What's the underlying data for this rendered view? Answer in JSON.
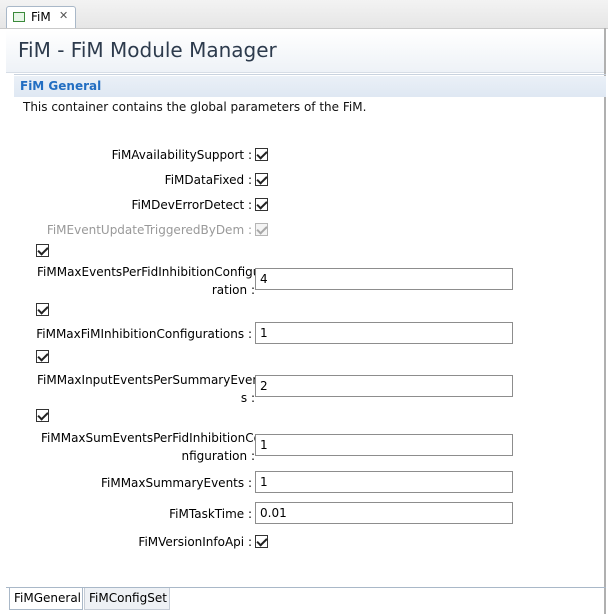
{
  "editor_tab": {
    "label": "FiM",
    "close_glyph": "✕",
    "icon": "module-icon"
  },
  "header": {
    "title": "FiM - FiM Module Manager"
  },
  "section": {
    "title": "FiM General",
    "description": "This container contains the global parameters of the FiM."
  },
  "params": {
    "availability": {
      "label": "FiMAvailabilitySupport :",
      "checked": true
    },
    "data_fixed": {
      "label": "FiMDataFixed :",
      "checked": true
    },
    "dev_error": {
      "label": "FiMDevErrorDetect :",
      "checked": true
    },
    "event_update": {
      "label": "FiMEventUpdateTriggeredByDem :",
      "checked": true,
      "disabled": true
    },
    "max_events_per_fid": {
      "label_line1": "FiMMaxEventsPerFidInhibitionConfigu",
      "label_line2": "ration :",
      "enabled": true,
      "value": "4"
    },
    "max_fim_inhibition": {
      "label": "FiMMaxFiMInhibitionConfigurations :",
      "enabled": true,
      "value": "1"
    },
    "max_input_events": {
      "label_line1": "FiMMaxInputEventsPerSummaryEvent",
      "label_line2": "s :",
      "enabled": true,
      "value": "2"
    },
    "max_sum_events": {
      "label_line1": "FiMMaxSumEventsPerFidInhibitionCo",
      "label_line2": "nfiguration :",
      "enabled": true,
      "value": "1"
    },
    "max_summary_events": {
      "label": "FiMMaxSummaryEvents :",
      "value": "1"
    },
    "task_time": {
      "label": "FiMTaskTime :",
      "value": "0.01"
    },
    "version_info": {
      "label": "FiMVersionInfoApi :",
      "checked": true
    }
  },
  "page_tabs": [
    "FiMGeneral",
    "FiMConfigSet"
  ],
  "active_page_tab": "FiMGeneral"
}
